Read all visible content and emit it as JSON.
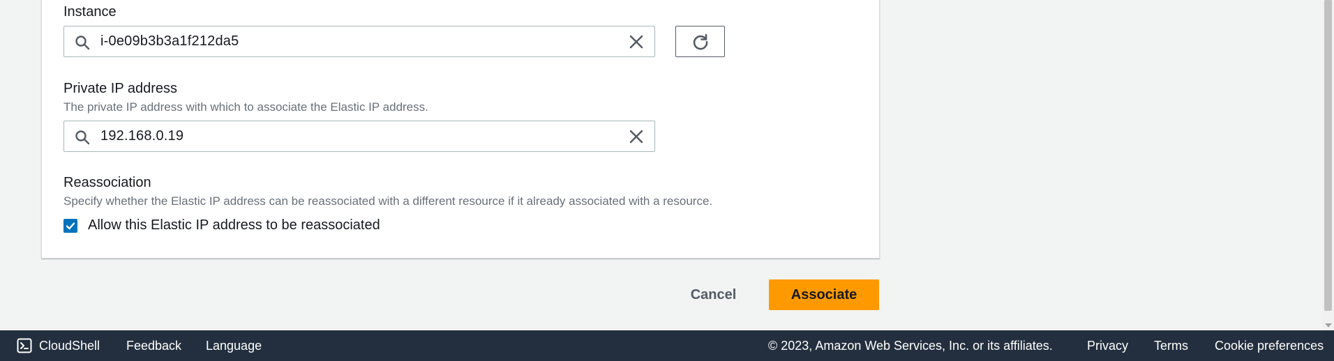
{
  "form": {
    "instance": {
      "label": "Instance",
      "value": "i-0e09b3b3a1f212da5"
    },
    "private_ip": {
      "label": "Private IP address",
      "description": "The private IP address with which to associate the Elastic IP address.",
      "value": "192.168.0.19"
    },
    "reassociation": {
      "label": "Reassociation",
      "description": "Specify whether the Elastic IP address can be reassociated with a different resource if it already associated with a resource.",
      "checkbox_label": "Allow this Elastic IP address to be reassociated",
      "checked": true
    }
  },
  "actions": {
    "cancel_label": "Cancel",
    "associate_label": "Associate"
  },
  "footer": {
    "cloudshell_label": "CloudShell",
    "feedback_label": "Feedback",
    "language_label": "Language",
    "copyright": "© 2023, Amazon Web Services, Inc. or its affiliates.",
    "privacy_label": "Privacy",
    "terms_label": "Terms",
    "cookie_label": "Cookie preferences"
  },
  "icons": {
    "search": "search-icon",
    "clear": "close-icon",
    "refresh": "refresh-icon",
    "check": "check-icon",
    "cloudshell": "terminal-icon"
  },
  "colors": {
    "primary_button": "#ff9900",
    "checkbox": "#0073bb",
    "footer_bg": "#232f3e",
    "page_bg": "#f2f3f3"
  }
}
